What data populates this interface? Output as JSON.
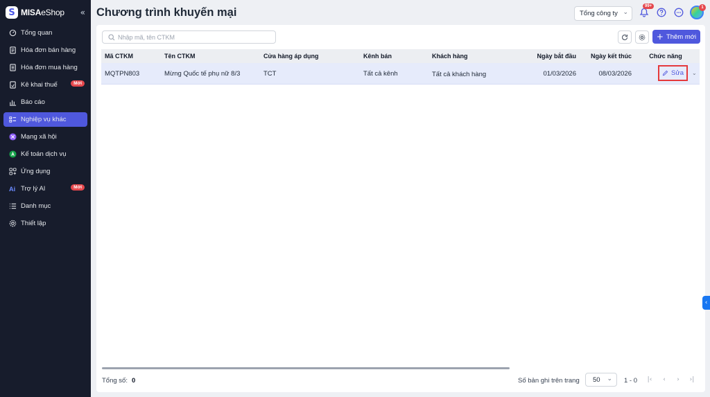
{
  "brand": {
    "logo_letter": "S",
    "name_bold": "MISA",
    "name_light": "eShop",
    "collapse_glyph": "«"
  },
  "sidebar": {
    "items": [
      {
        "label": "Tổng quan",
        "icon": "dashboard-icon"
      },
      {
        "label": "Hóa đơn bán hàng",
        "icon": "invoice-icon"
      },
      {
        "label": "Hóa đơn mua hàng",
        "icon": "purchase-invoice-icon"
      },
      {
        "label": "Kê khai thuế",
        "icon": "tax-declaration-icon",
        "badge": "Mới"
      },
      {
        "label": "Báo cáo",
        "icon": "report-icon"
      },
      {
        "label": "Nghiệp vụ khác",
        "icon": "list-icon",
        "active": true
      },
      {
        "label": "Mạng xã hội",
        "icon": "social-icon"
      },
      {
        "label": "Kế toán dịch vụ",
        "icon": "accounting-service-icon"
      },
      {
        "label": "Ứng dụng",
        "icon": "apps-icon"
      },
      {
        "label": "Trợ lý AI",
        "icon": "ai-icon",
        "badge": "Mới"
      },
      {
        "label": "Danh mục",
        "icon": "catalog-icon"
      },
      {
        "label": "Thiết lập",
        "icon": "settings-icon"
      }
    ]
  },
  "header": {
    "title": "Chương trình khuyến mại",
    "company_select": "Tổng công ty",
    "notification_badge": "99+",
    "avatar_badge": "1"
  },
  "toolbar": {
    "search_placeholder": "Nhập mã, tên CTKM",
    "add_label": "Thêm mới",
    "add_glyph": "+"
  },
  "table": {
    "columns": [
      "Mã CTKM",
      "Tên CTKM",
      "Cửa hàng áp dụng",
      "Kênh bán",
      "Khách hàng",
      "Ngày bắt đầu",
      "Ngày kết thúc",
      "Chức năng"
    ],
    "rows": [
      {
        "code": "MQTPN803",
        "name": "Mừng Quốc tế phụ nữ 8/3",
        "store": "TCT",
        "channel": "Tất cả kênh",
        "customer": "Tất cả khách hàng",
        "start_date": "01/03/2026",
        "end_date": "08/03/2026",
        "action_label": "Sửa"
      }
    ]
  },
  "footer": {
    "total_label": "Tổng số:",
    "total_value": "0",
    "per_page_label": "Số bản ghi trên trang",
    "per_page_value": "50",
    "range": "1 - 0"
  },
  "colors": {
    "accent": "#4f58dd",
    "sidebar_bg": "#171c2c",
    "badge_red": "#e5484d",
    "row_highlight": "#e6ebfb"
  }
}
